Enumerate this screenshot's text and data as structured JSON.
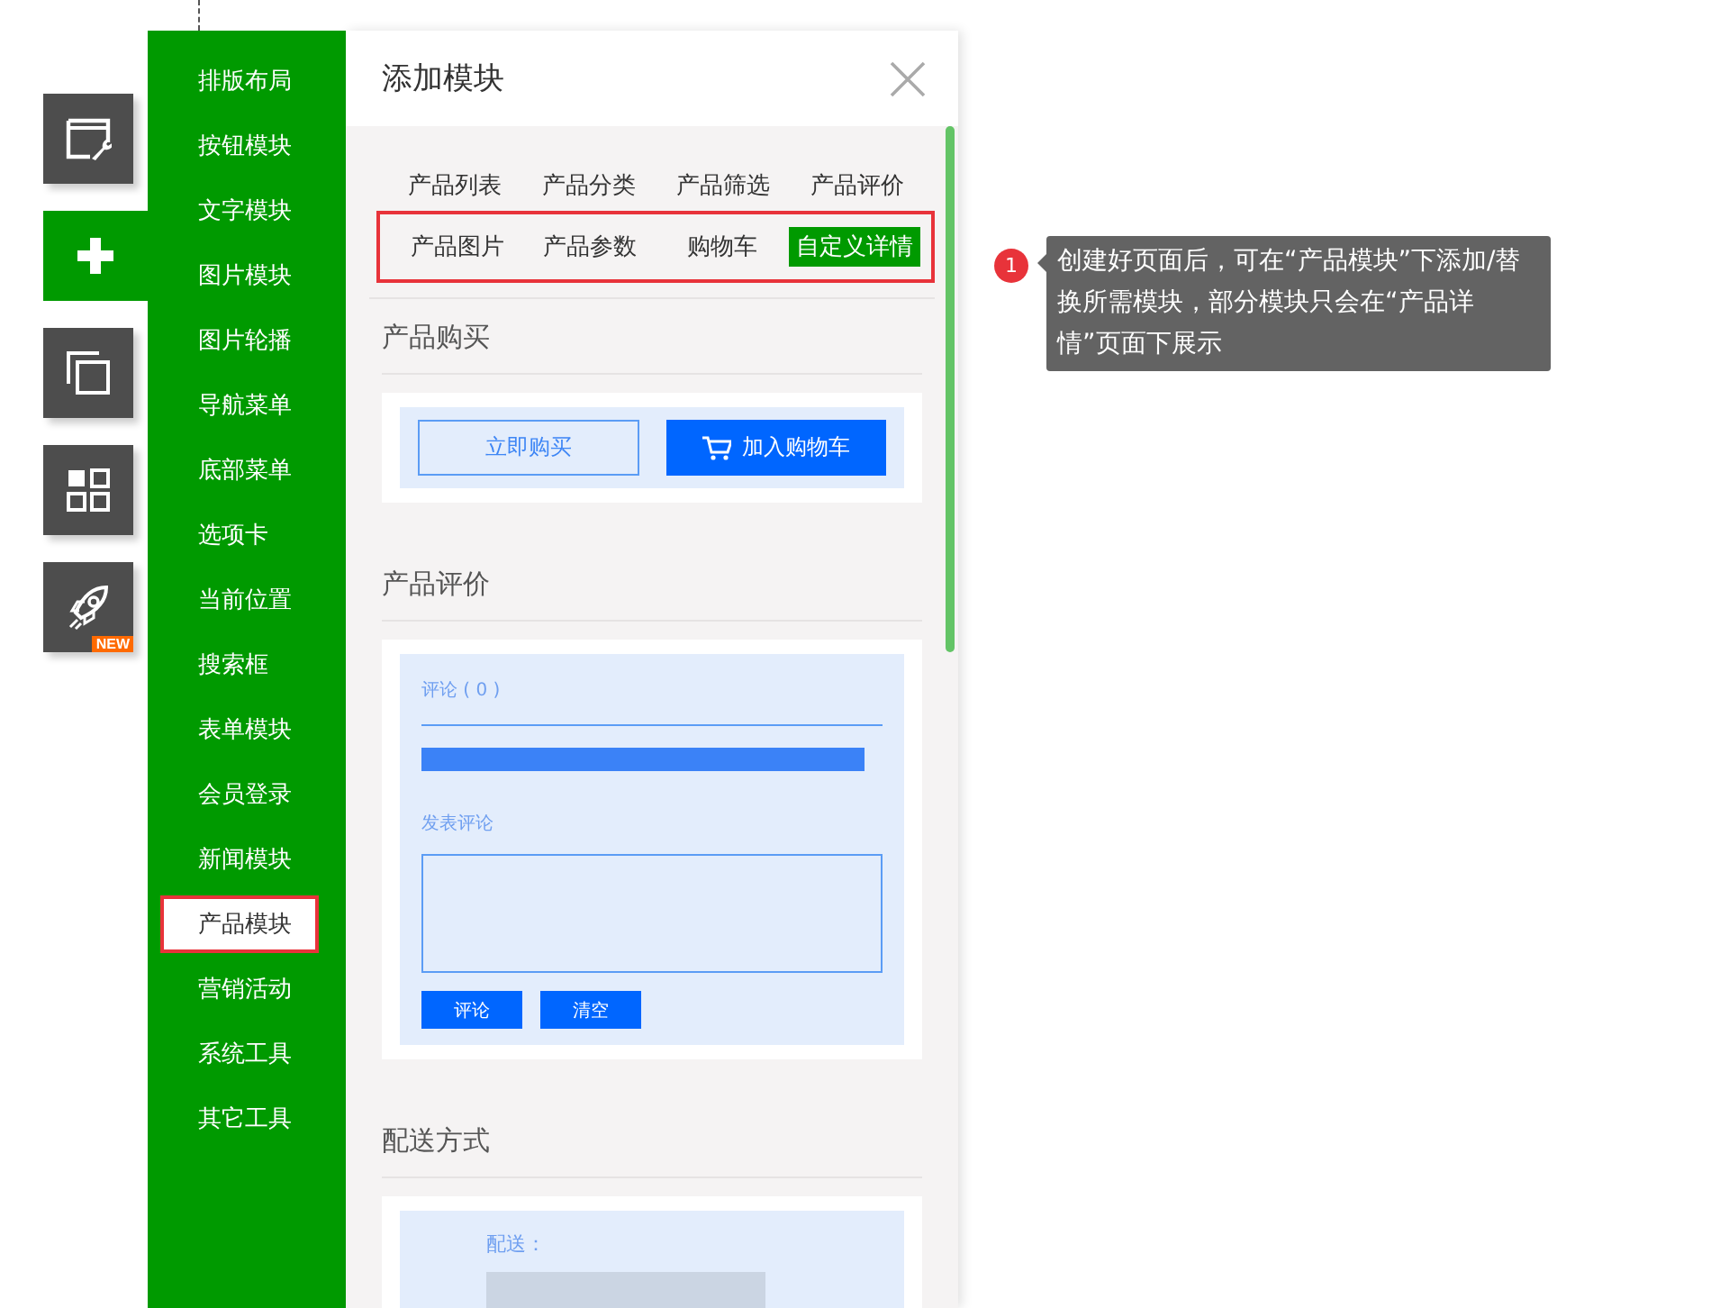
{
  "toolbar": [
    {
      "kind": "layout",
      "selected": false
    },
    {
      "kind": "add",
      "selected": true
    },
    {
      "kind": "pages",
      "selected": false
    },
    {
      "kind": "apps",
      "selected": false
    },
    {
      "kind": "launch",
      "selected": false,
      "badge": "NEW"
    }
  ],
  "sidebar": {
    "items": [
      {
        "label": "排版布局",
        "selected": false
      },
      {
        "label": "按钮模块",
        "selected": false
      },
      {
        "label": "文字模块",
        "selected": false
      },
      {
        "label": "图片模块",
        "selected": false
      },
      {
        "label": "图片轮播",
        "selected": false
      },
      {
        "label": "导航菜单",
        "selected": false
      },
      {
        "label": "底部菜单",
        "selected": false
      },
      {
        "label": "选项卡",
        "selected": false
      },
      {
        "label": "当前位置",
        "selected": false
      },
      {
        "label": "搜索框",
        "selected": false
      },
      {
        "label": "表单模块",
        "selected": false
      },
      {
        "label": "会员登录",
        "selected": false
      },
      {
        "label": "新闻模块",
        "selected": false
      },
      {
        "label": "产品模块",
        "selected": true
      },
      {
        "label": "营销活动",
        "selected": false
      },
      {
        "label": "系统工具",
        "selected": false
      },
      {
        "label": "其它工具",
        "selected": false
      }
    ]
  },
  "panel": {
    "title": "添加模块",
    "tab_rows": [
      {
        "highlighted": false,
        "tabs": [
          {
            "label": "产品列表",
            "selected": false
          },
          {
            "label": "产品分类",
            "selected": false
          },
          {
            "label": "产品筛选",
            "selected": false
          },
          {
            "label": "产品评价",
            "selected": false
          }
        ]
      },
      {
        "highlighted": true,
        "tabs": [
          {
            "label": "产品图片",
            "selected": false
          },
          {
            "label": "产品参数",
            "selected": false
          },
          {
            "label": "购物车",
            "selected": false
          },
          {
            "label": "自定义详情",
            "selected": true
          }
        ]
      }
    ],
    "sections": [
      {
        "kind": "buy",
        "title": "产品购买",
        "buttons": [
          "立即购买",
          "加入购物车"
        ]
      },
      {
        "kind": "review",
        "title": "产品评价",
        "count_label": "评论 ( 0 )",
        "post_label": "发表评论",
        "buttons": [
          "评论",
          "清空"
        ]
      },
      {
        "kind": "delivery",
        "title": "配送方式",
        "label": "配送："
      }
    ]
  },
  "tooltip": {
    "number": "1",
    "text": "创建好页面后，可在“产品模块”下添加/替换所需模块，部分模块只会在“产品详情”页面下展示"
  }
}
